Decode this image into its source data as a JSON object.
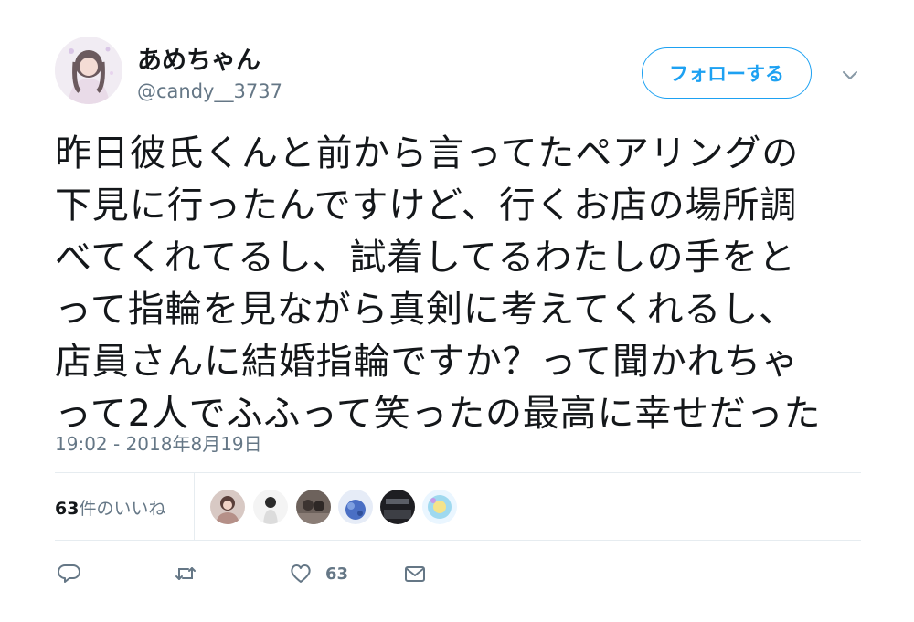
{
  "user": {
    "display_name": "あめちゃん",
    "handle": "@candy__3737"
  },
  "follow_button": {
    "label": "フォローする"
  },
  "tweet": {
    "lines": [
      "昨日彼氏くんと前から言ってたペアリングの",
      "下見に行ったんですけど、行くお店の場所調",
      "べてくれてるし、試着してるわたしの手をと",
      "って指輪を見ながら真剣に考えてくれるし、",
      "店員さんに結婚指輪ですか？って聞かれちゃ",
      "って2人でふふって笑ったの最高に幸せだった"
    ],
    "timestamp": "19:02 - 2018年8月19日"
  },
  "likes": {
    "count": "63",
    "suffix": "件のいいね",
    "likers": [
      "liker-1",
      "liker-2",
      "liker-3",
      "liker-4",
      "liker-5",
      "liker-6"
    ]
  },
  "actions": {
    "reply_icon": "reply-icon",
    "retweet_icon": "retweet-icon",
    "like_icon": "heart-icon",
    "like_count": "63",
    "dm_icon": "envelope-icon"
  },
  "colors": {
    "accent": "#1da1f2",
    "secondary_text": "#657786",
    "divider": "#e6ecf0"
  }
}
